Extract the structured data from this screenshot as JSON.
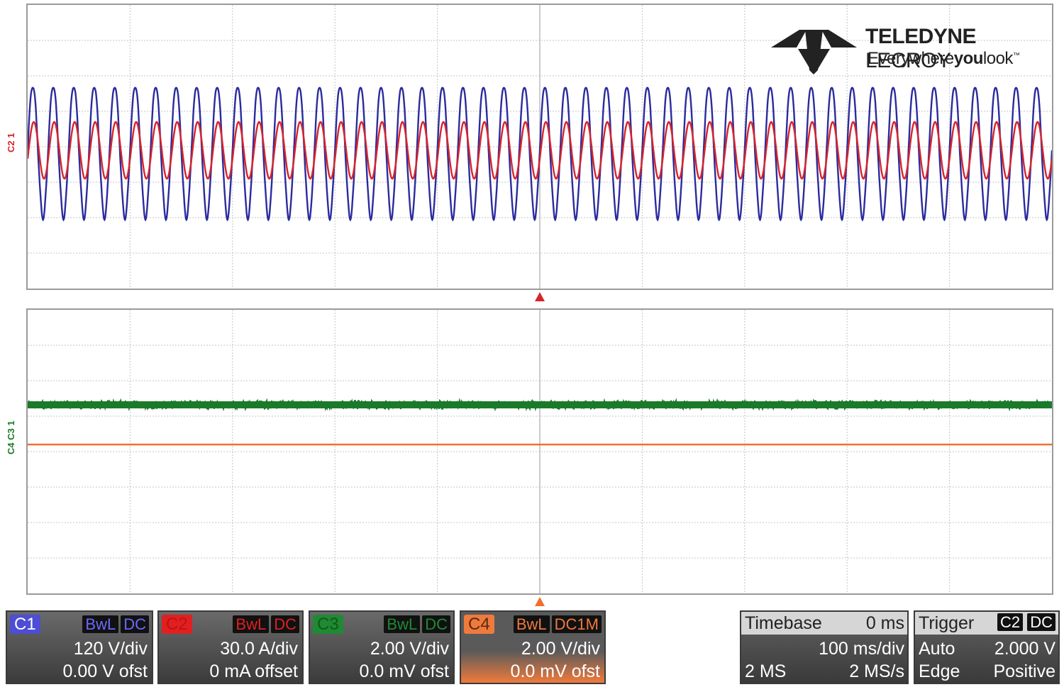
{
  "brand": {
    "name_bold": "TELEDYNE",
    "name_regular": "LECROY",
    "tagline_pre": "Everywhere",
    "tagline_bold": "you",
    "tagline_post": "look",
    "tagline_tm": "™"
  },
  "markers": {
    "c2_c1": "C2 1",
    "c4_c3": "C4 C3 1"
  },
  "channels": [
    {
      "tag": "C1",
      "flag1": "BwL",
      "flag2": "DC",
      "scale": "120 V/div",
      "offset": "0.00 V ofst",
      "color": "#2b2b9e",
      "tag_color": "#4d4dd6"
    },
    {
      "tag": "C2",
      "flag1": "BwL",
      "flag2": "DC",
      "scale": "30.0 A/div",
      "offset": "0 mA offset",
      "color": "#d8242b",
      "tag_color": "#e02020"
    },
    {
      "tag": "C3",
      "flag1": "BwL",
      "flag2": "DC",
      "scale": "2.00 V/div",
      "offset": "0.0 mV ofst",
      "color": "#1b7a2a",
      "tag_color": "#1f8a33"
    },
    {
      "tag": "C4",
      "flag1": "BwL",
      "flag2": "DC1M",
      "scale": "2.00 V/div",
      "offset": "0.0 mV ofst",
      "color": "#f07030",
      "tag_color": "#f07a3c"
    }
  ],
  "timebase": {
    "label": "Timebase",
    "delay": "0 ms",
    "scale": "100 ms/div",
    "samples": "2 MS",
    "rate": "2 MS/s"
  },
  "trigger": {
    "label": "Trigger",
    "source": "C2",
    "coupling": "DC",
    "mode": "Auto",
    "level": "2.000 V",
    "type": "Edge",
    "slope": "Positive"
  },
  "colors": {
    "c1_trace": "#2b2b9e",
    "c2_trace": "#d8242b",
    "c3_trace": "#1b7a2a",
    "c4_trace": "#f07030",
    "trigger_marker": "#d8242b",
    "delay_marker": "#f07030",
    "grid": "#bcbcbc"
  }
}
